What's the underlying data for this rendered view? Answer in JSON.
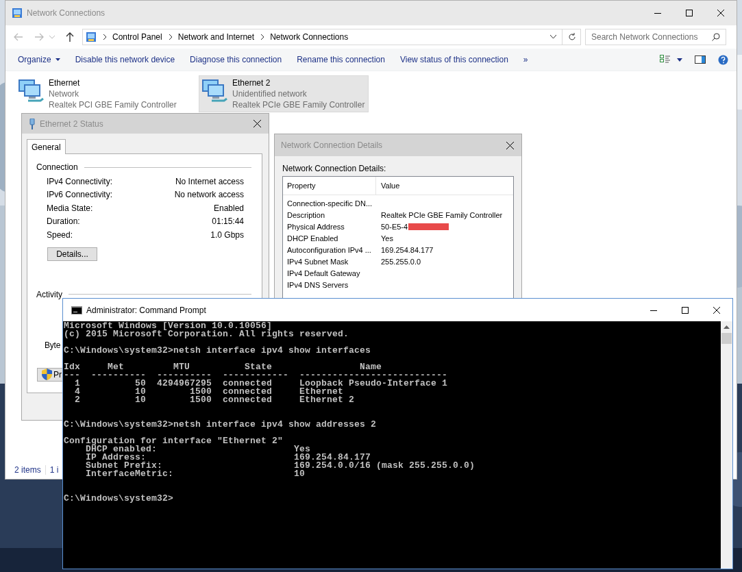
{
  "explorer": {
    "title": "Network Connections",
    "breadcrumbs": [
      "Control Panel",
      "Network and Internet",
      "Network Connections"
    ],
    "search": {
      "placeholder": "Search Network Connections"
    },
    "organize": "Organize",
    "commands": [
      "Disable this network device",
      "Diagnose this connection",
      "Rename this connection",
      "View status of this connection"
    ],
    "overflow": "»",
    "items": [
      {
        "name": "Ethernet",
        "status": "Network",
        "device": "Realtek PCI GBE Family Controller",
        "selected": false
      },
      {
        "name": "Ethernet 2",
        "status": "Unidentified network",
        "device": "Realtek PCIe GBE Family Controller",
        "selected": true
      }
    ],
    "status_bar": [
      "2 items",
      "1 i"
    ]
  },
  "status_dialog": {
    "title": "Ethernet 2 Status",
    "tabs": [
      {
        "label": "General",
        "selected": true
      }
    ],
    "connection_heading": "Connection",
    "rows": [
      {
        "label": "IPv4 Connectivity:",
        "value": "No Internet access"
      },
      {
        "label": "IPv6 Connectivity:",
        "value": "No network access"
      },
      {
        "label": "Media State:",
        "value": "Enabled"
      },
      {
        "label": "Duration:",
        "value": "01:15:44"
      },
      {
        "label": "Speed:",
        "value": "1.0 Gbps"
      }
    ],
    "details_button": "Details...",
    "activity_heading": "Activity",
    "bytes_label": "Byte",
    "properties_button": "Pr"
  },
  "details_dialog": {
    "title": "Network Connection Details",
    "caption": "Network Connection Details:",
    "columns": [
      "Property",
      "Value"
    ],
    "rows": [
      {
        "property": "Connection-specific DN...",
        "redacted": false
      },
      {
        "property": "Description",
        "value": "Realtek PCIe GBE Family Controller",
        "redacted": false
      },
      {
        "property": "Physical Address",
        "value": "50-E5-4",
        "redacted": true
      },
      {
        "property": "DHCP Enabled",
        "value": "Yes",
        "redacted": false
      },
      {
        "property": "Autoconfiguration IPv4 ...",
        "value": "169.254.84.177",
        "redacted": false
      },
      {
        "property": "IPv4 Subnet Mask",
        "value": "255.255.0.0",
        "redacted": false
      },
      {
        "property": "IPv4 Default Gateway",
        "redacted": false
      },
      {
        "property": "IPv4 DNS Servers",
        "redacted": false
      }
    ]
  },
  "console": {
    "title": "Administrator: Command Prompt",
    "lines": [
      {
        "kind": "text",
        "text": "Microsoft Windows [Version 10.0.10056]"
      },
      {
        "kind": "text",
        "text": "(c) 2015 Microsoft Corporation. All rights reserved."
      },
      {
        "kind": "blank"
      },
      {
        "kind": "text",
        "text": "C:\\Windows\\system32>netsh interface ipv4 show interfaces"
      },
      {
        "kind": "blank"
      },
      {
        "kind": "text",
        "text": "Idx     Met         MTU          State                Name"
      },
      {
        "kind": "text",
        "text": "---  ----------  ----------  ------------  ---------------------------"
      },
      {
        "kind": "text",
        "text": "  1          50  4294967295  connected     Loopback Pseudo-Interface 1"
      },
      {
        "kind": "text",
        "text": "  4          10        1500  connected     Ethernet"
      },
      {
        "kind": "text",
        "text": "  2          10        1500  connected     Ethernet 2"
      },
      {
        "kind": "blank"
      },
      {
        "kind": "blank"
      },
      {
        "kind": "text",
        "text": "C:\\Windows\\system32>netsh interface ipv4 show addresses 2"
      },
      {
        "kind": "blank"
      },
      {
        "kind": "text",
        "text": "Configuration for interface \"Ethernet 2\""
      },
      {
        "kind": "text",
        "text": "    DHCP enabled:                         Yes"
      },
      {
        "kind": "text",
        "text": "    IP Address:                           169.254.84.177"
      },
      {
        "kind": "text",
        "text": "    Subnet Prefix:                        169.254.0.0/16 (mask 255.255.0.0)"
      },
      {
        "kind": "text",
        "text": "    InterfaceMetric:                      10"
      },
      {
        "kind": "blank"
      },
      {
        "kind": "blank"
      },
      {
        "kind": "text",
        "text": "C:\\Windows\\system32>"
      }
    ]
  }
}
